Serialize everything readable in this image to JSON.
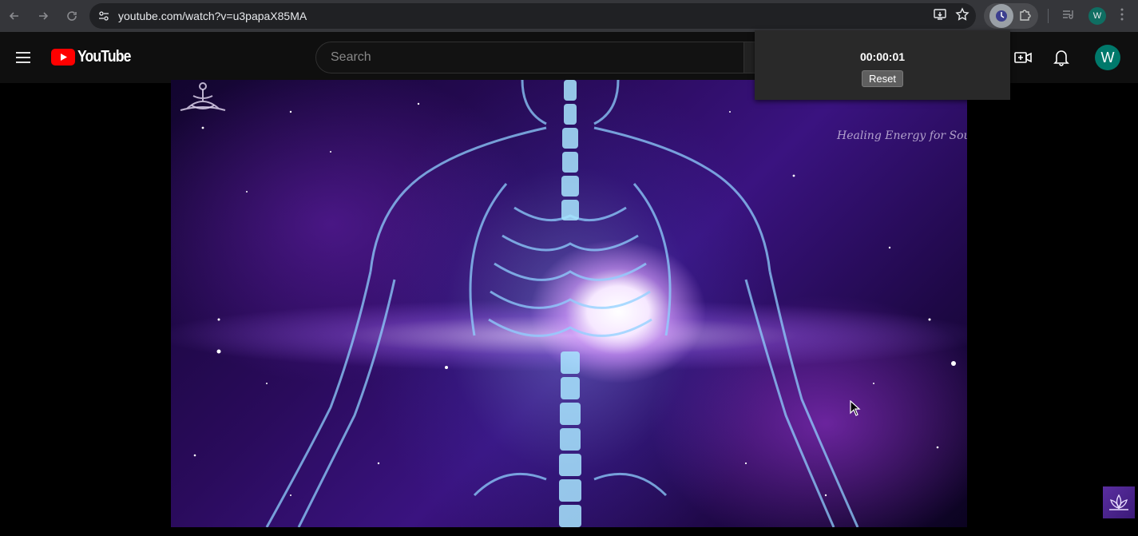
{
  "browser": {
    "url": "youtube.com/watch?v=u3papaX85MA",
    "profile_initial": "W"
  },
  "masthead": {
    "logo_text": "YouTube",
    "search_placeholder": "Search",
    "avatar_initial": "W"
  },
  "timer_popup": {
    "time": "00:00:01",
    "reset_label": "Reset"
  },
  "video": {
    "watermark": "Healing Energy for Soul"
  },
  "colors": {
    "youtube_red": "#ff0000",
    "avatar": "#00796b",
    "browser_bar": "#35363a"
  }
}
